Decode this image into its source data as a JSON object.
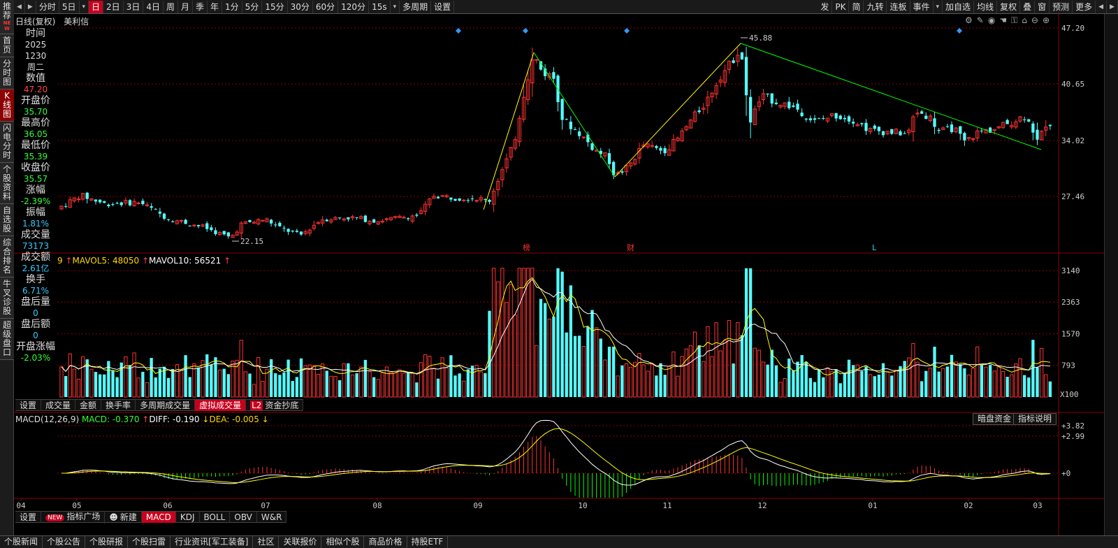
{
  "left_nav": [
    {
      "label": "推荐",
      "tag": "NEW",
      "active": false
    },
    {
      "label": "首页",
      "active": false
    },
    {
      "label": "分时图",
      "active": false
    },
    {
      "label": "K线图",
      "active": true
    },
    {
      "label": "闪电分时",
      "active": false
    },
    {
      "label": "个股资料",
      "active": false
    },
    {
      "label": "自选股",
      "active": false
    },
    {
      "label": "综合排名",
      "active": false
    },
    {
      "label": "牛叉诊股",
      "active": false
    },
    {
      "label": "超级盘口",
      "active": false
    }
  ],
  "toolbar": {
    "left": [
      "◀",
      "▶",
      "分时",
      "5日",
      "▾",
      "日",
      "2日",
      "3日",
      "4日",
      "周",
      "月",
      "季",
      "年",
      "1分",
      "5分",
      "15分",
      "30分",
      "60分",
      "120分",
      "15s",
      "▾",
      "多周期",
      "设置"
    ],
    "active": "日",
    "right": [
      "发",
      "PK",
      "简",
      "九转",
      "连板",
      "事件",
      "▾",
      "加自选",
      "均线",
      "复权",
      "叠",
      "窗",
      "预测",
      "更多",
      "◀",
      "▶"
    ]
  },
  "title": {
    "type": "日线(复权)",
    "name": "美利信"
  },
  "top_icons": [
    "gear-icon",
    "pen-icon",
    "eye-icon",
    "hand-icon",
    "lock-icon",
    "home-icon",
    "zoom-out-icon",
    "zoom-in-icon"
  ],
  "info": [
    {
      "label": "时间",
      "values": [
        "2025",
        "1230",
        "周二"
      ],
      "color": "#dddddd"
    },
    {
      "label": "数值",
      "values": [
        "47.20"
      ],
      "color": "#ff4444"
    },
    {
      "label": "开盘价",
      "values": [
        "35.70"
      ],
      "color": "#33ff33"
    },
    {
      "label": "最高价",
      "values": [
        "36.05"
      ],
      "color": "#33ff33"
    },
    {
      "label": "最低价",
      "values": [
        "35.39"
      ],
      "color": "#33ff33"
    },
    {
      "label": "收盘价",
      "values": [
        "35.57"
      ],
      "color": "#33ff33"
    },
    {
      "label": "涨幅",
      "values": [
        "-2.39%"
      ],
      "color": "#33ff33"
    },
    {
      "label": "振幅",
      "values": [
        "1.81%"
      ],
      "color": "#33ccff"
    },
    {
      "label": "成交量",
      "values": [
        "73173"
      ],
      "color": "#33ccff"
    },
    {
      "label": "成交额",
      "values": [
        "2.61亿"
      ],
      "color": "#33ccff"
    },
    {
      "label": "换手",
      "values": [
        "6.71%"
      ],
      "color": "#33ccff"
    },
    {
      "label": "盘后量",
      "values": [
        "0"
      ],
      "color": "#33ccff"
    },
    {
      "label": "盘后额",
      "values": [
        "0"
      ],
      "color": "#33ccff"
    },
    {
      "label": "开盘涨幅",
      "values": [
        "-2.03%"
      ],
      "color": "#33ff33"
    }
  ],
  "price_axis": [
    "47.20",
    "40.65",
    "34.02",
    "27.46"
  ],
  "price_markers": {
    "high": "45.88",
    "low": "22.15"
  },
  "event_marks": [
    "榜",
    "财",
    "L"
  ],
  "vol_header": {
    "prefix": "9",
    "mavol5": "MAVOL5: 48050",
    "mavol10": "MAVOL10: 56521"
  },
  "vol_axis": [
    "3140",
    "2363",
    "1570",
    "793",
    "X100"
  ],
  "vol_tabs": [
    "设置",
    "成交量",
    "金额",
    "换手率",
    "多周期成交量",
    "虚拟成交量",
    "资金抄底"
  ],
  "vol_tabs_active": "虚拟成交量",
  "vol_tab_l2": "L2",
  "macd_header": {
    "name": "MACD(12,26,9)",
    "macd": "MACD: -0.370",
    "diff": "DIFF: -0.190",
    "dea": "DEA: -0.005"
  },
  "macd_buttons": [
    "暗盘资金",
    "指标说明"
  ],
  "macd_axis": [
    "+3.82",
    "+2.99",
    "+0"
  ],
  "months": [
    "04",
    "05",
    "06",
    "07",
    "08",
    "09",
    "10",
    "11",
    "12",
    "01",
    "02",
    "03"
  ],
  "ind_tabs": [
    "设置",
    "指标广场",
    "新建",
    "MACD",
    "KDJ",
    "BOLL",
    "OBV",
    "W&R"
  ],
  "ind_tabs_active": "MACD",
  "news_bar": [
    "个股新闻",
    "个股公告",
    "个股研报",
    "个股扫雷",
    "行业资讯[军工装备]",
    "社区",
    "关联报价",
    "相似个股",
    "商品价格",
    "持股ETF"
  ],
  "colors": {
    "up": "#ff3232",
    "down": "#54ffff",
    "ma_fast": "#ffff00",
    "ma_slow": "#ffffff",
    "zigzag_up": "#ffff00",
    "zigzag_down": "#00ff00",
    "grid": "#8b0000"
  },
  "chart_data": {
    "type": "candlestick",
    "key_points": [
      {
        "month": "04",
        "price": 26.0
      },
      {
        "month": "05",
        "price": 27.4
      },
      {
        "month": "07",
        "price": 22.15
      },
      {
        "month": "09",
        "price": 26.2
      },
      {
        "month": "09",
        "price": 44.0
      },
      {
        "month": "10",
        "price": 29.8
      },
      {
        "month": "11",
        "price": 45.88
      },
      {
        "month": "03",
        "price": 33.2
      }
    ]
  }
}
